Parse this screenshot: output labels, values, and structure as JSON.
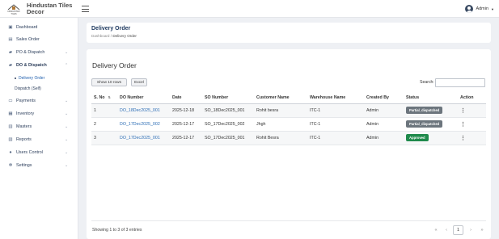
{
  "brand": {
    "logo_text": "HINDUSTAN TILES",
    "name_line1": "Hindustan Tiles",
    "name_line2": "Decor"
  },
  "user": {
    "name": "Admin"
  },
  "colors": {
    "primary": "#1f3a60",
    "link": "#2f6fb6",
    "partial": "#6c757d",
    "approved": "#1f8a4c"
  },
  "sidebar": {
    "items": [
      {
        "label": "Dashboard",
        "icon": "dashboard-icon"
      },
      {
        "label": "Sales Order",
        "icon": "sales-icon"
      },
      {
        "label": "PO & Dispatch",
        "icon": "truck-icon"
      },
      {
        "label": "DO & Dispatch",
        "icon": "truck-icon"
      },
      {
        "label": "Payments",
        "icon": "payment-icon"
      },
      {
        "label": "Inventory",
        "icon": "inventory-icon"
      },
      {
        "label": "Masters",
        "icon": "masters-icon"
      },
      {
        "label": "Reports",
        "icon": "reports-icon"
      },
      {
        "label": "Users Control",
        "icon": "users-icon"
      },
      {
        "label": "Settings",
        "icon": "gear-icon"
      }
    ],
    "subitems": [
      {
        "label": "Delivery Order"
      },
      {
        "label": "Dispatch (Self)"
      }
    ]
  },
  "header": {
    "title": "Delivery Order",
    "breadcrumb_home": "Dashboard",
    "breadcrumb_sep": "/",
    "breadcrumb_current": "Delivery Order"
  },
  "main": {
    "title": "Delivery Order",
    "show_rows": "Show 10 rows",
    "excel": "Excel",
    "search_label": "Search:",
    "search_value": "",
    "columns": [
      "S. No",
      "DO Number",
      "Date",
      "SO Number",
      "Customer Name",
      "Warehouse Name",
      "Created By",
      "Status",
      "Action"
    ],
    "rows": [
      {
        "sno": "1",
        "do_number": "DO_18Dec2025_001",
        "date": "2025-12-18",
        "so_number": "SO_18Dec2025_001",
        "customer": "Rohit besra",
        "warehouse": "ITC-1",
        "created_by": "Admin",
        "status": "Partial_dispatched",
        "status_type": "partial"
      },
      {
        "sno": "2",
        "do_number": "DO_17Dec2025_002",
        "date": "2025-12-17",
        "so_number": "SO_17Dec2025_002",
        "customer": "Jhgh",
        "warehouse": "ITC-1",
        "created_by": "Admin",
        "status": "Partial_dispatched",
        "status_type": "partial"
      },
      {
        "sno": "3",
        "do_number": "DO_17Dec2025_001",
        "date": "2025-12-17",
        "so_number": "SO_17Dec2025_001",
        "customer": "Rohit Besra",
        "warehouse": "ITC-1",
        "created_by": "Admin",
        "status": "Approved",
        "status_type": "approved"
      }
    ],
    "info": "Showing 1 to 3 of 3 entries",
    "pager": {
      "first": "«",
      "prev": "‹",
      "page": "1",
      "next": "›",
      "last": "»"
    }
  }
}
